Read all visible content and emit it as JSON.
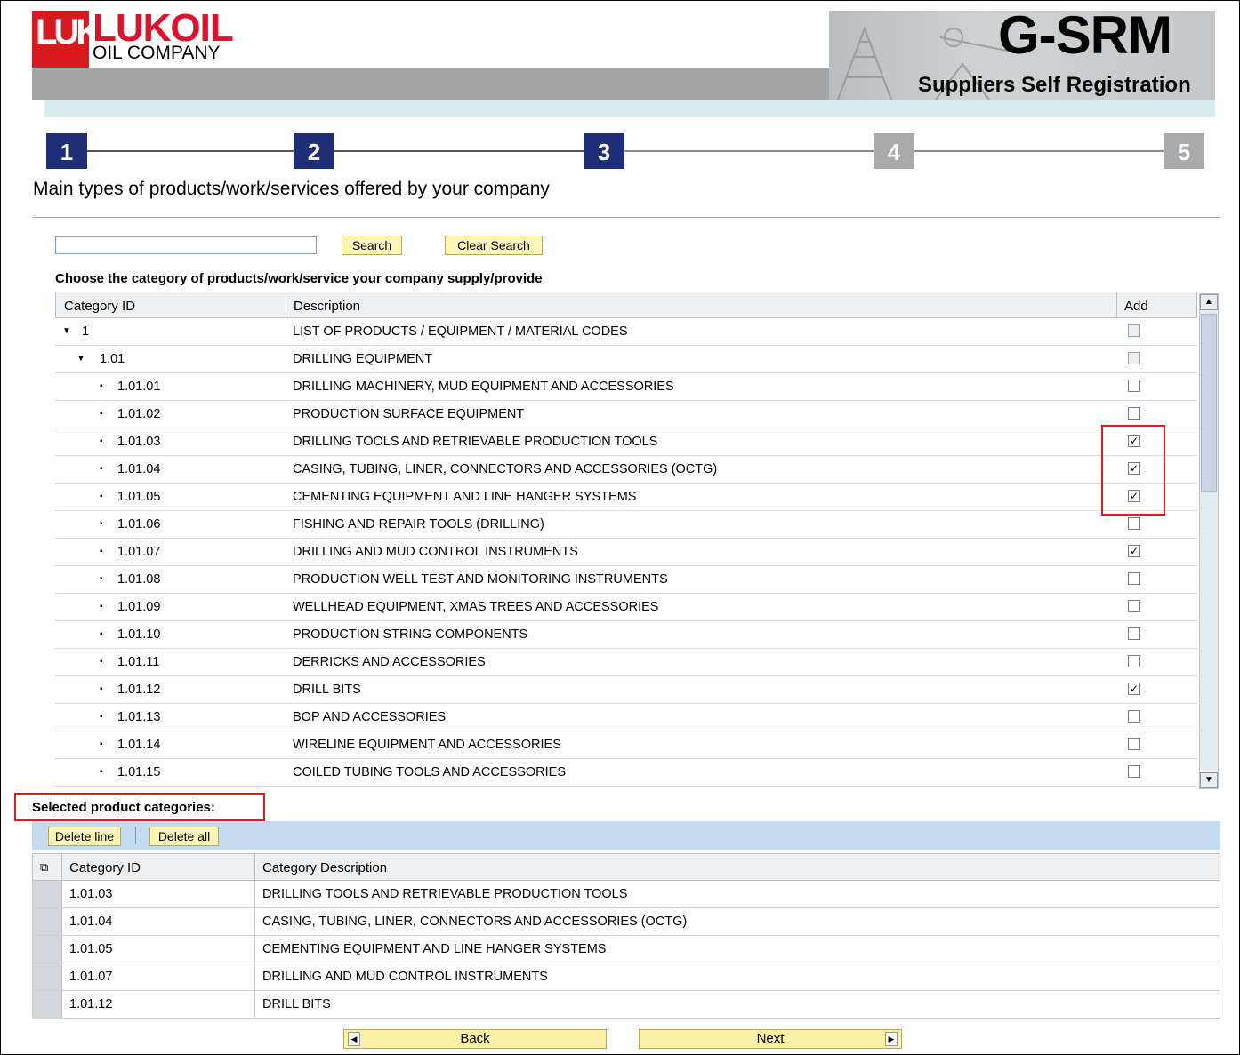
{
  "header": {
    "logo_letters": "LUK",
    "brand": "LUKOIL",
    "brand_sub": "OIL COMPANY",
    "app_title": "G-SRM",
    "app_subtitle": "Suppliers Self Registration"
  },
  "steps": [
    "1",
    "2",
    "3",
    "4",
    "5"
  ],
  "current_step": 3,
  "page_title": "Main types of products/work/services offered by your company",
  "search": {
    "value": "",
    "search_label": "Search",
    "clear_label": "Clear Search"
  },
  "choose_label": "Choose the category of products/work/service your company supply/provide",
  "tree": {
    "columns": [
      "Category ID",
      "Description",
      "Add"
    ],
    "rows": [
      {
        "id": "1",
        "desc": "LIST OF PRODUCTS / EQUIPMENT / MATERIAL CODES",
        "marker": "▼",
        "level": 0,
        "checked": false,
        "disabled": true
      },
      {
        "id": "1.01",
        "desc": "DRILLING EQUIPMENT",
        "marker": "▼",
        "level": 1,
        "checked": false,
        "disabled": true
      },
      {
        "id": "1.01.01",
        "desc": "DRILLING MACHINERY, MUD EQUIPMENT AND ACCESSORIES",
        "marker": "▪",
        "level": 2,
        "checked": false
      },
      {
        "id": "1.01.02",
        "desc": "PRODUCTION SURFACE EQUIPMENT",
        "marker": "▪",
        "level": 2,
        "checked": false
      },
      {
        "id": "1.01.03",
        "desc": "DRILLING TOOLS AND RETRIEVABLE PRODUCTION TOOLS",
        "marker": "▪",
        "level": 2,
        "checked": true
      },
      {
        "id": "1.01.04",
        "desc": "CASING, TUBING, LINER, CONNECTORS AND ACCESSORIES (OCTG)",
        "marker": "▪",
        "level": 2,
        "checked": true
      },
      {
        "id": "1.01.05",
        "desc": "CEMENTING EQUIPMENT AND LINE HANGER SYSTEMS",
        "marker": "▪",
        "level": 2,
        "checked": true
      },
      {
        "id": "1.01.06",
        "desc": "FISHING AND REPAIR TOOLS (DRILLING)",
        "marker": "▪",
        "level": 2,
        "checked": false
      },
      {
        "id": "1.01.07",
        "desc": "DRILLING AND MUD CONTROL INSTRUMENTS",
        "marker": "▪",
        "level": 2,
        "checked": true
      },
      {
        "id": "1.01.08",
        "desc": "PRODUCTION WELL TEST AND MONITORING INSTRUMENTS",
        "marker": "▪",
        "level": 2,
        "checked": false
      },
      {
        "id": "1.01.09",
        "desc": "WELLHEAD EQUIPMENT, XMAS TREES AND ACCESSORIES",
        "marker": "▪",
        "level": 2,
        "checked": false
      },
      {
        "id": "1.01.10",
        "desc": "PRODUCTION STRING COMPONENTS",
        "marker": "▪",
        "level": 2,
        "checked": false
      },
      {
        "id": "1.01.11",
        "desc": "DERRICKS AND ACCESSORIES",
        "marker": "▪",
        "level": 2,
        "checked": false
      },
      {
        "id": "1.01.12",
        "desc": "DRILL BITS",
        "marker": "▪",
        "level": 2,
        "checked": true
      },
      {
        "id": "1.01.13",
        "desc": "BOP AND ACCESSORIES",
        "marker": "▪",
        "level": 2,
        "checked": false
      },
      {
        "id": "1.01.14",
        "desc": "WIRELINE EQUIPMENT AND ACCESSORIES",
        "marker": "▪",
        "level": 2,
        "checked": false
      },
      {
        "id": "1.01.15",
        "desc": "COILED TUBING TOOLS AND ACCESSORIES",
        "marker": "▪",
        "level": 2,
        "checked": false
      }
    ]
  },
  "selected": {
    "label": "Selected product categories:",
    "delete_line_label": "Delete line",
    "delete_all_label": "Delete all",
    "columns": [
      "Category ID",
      "Category Description"
    ],
    "rows": [
      {
        "id": "1.01.03",
        "desc": "DRILLING TOOLS AND RETRIEVABLE PRODUCTION TOOLS"
      },
      {
        "id": "1.01.04",
        "desc": "CASING, TUBING, LINER, CONNECTORS AND ACCESSORIES (OCTG)"
      },
      {
        "id": "1.01.05",
        "desc": "CEMENTING EQUIPMENT AND LINE HANGER SYSTEMS"
      },
      {
        "id": "1.01.07",
        "desc": "DRILLING AND MUD CONTROL INSTRUMENTS"
      },
      {
        "id": "1.01.12",
        "desc": "DRILL BITS"
      }
    ]
  },
  "nav": {
    "back_label": "Back",
    "next_label": "Next"
  },
  "colors": {
    "brand_red": "#d71920",
    "step_active": "#1e2f78",
    "step_inactive": "#a9aaab",
    "button_yellow": "#fff6b4",
    "highlight_red": "#e21c1c"
  }
}
